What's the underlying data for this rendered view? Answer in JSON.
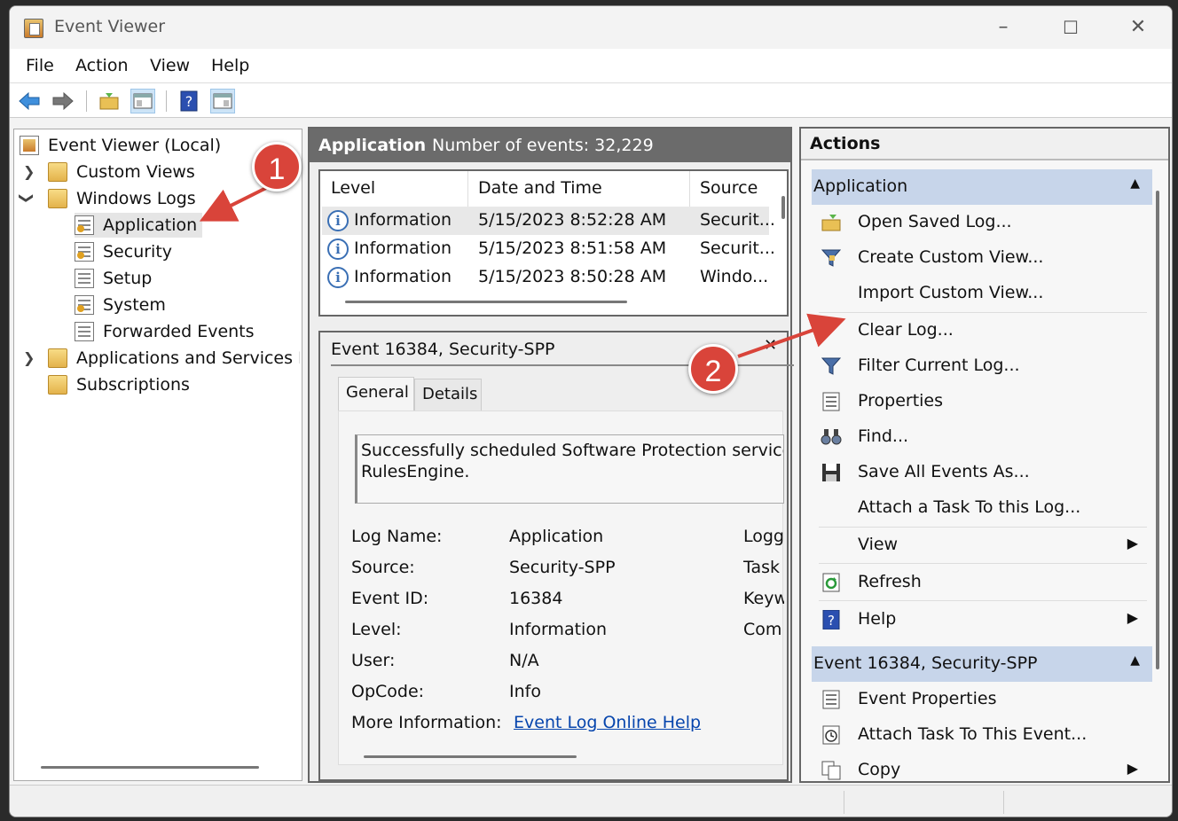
{
  "window": {
    "title": "Event Viewer",
    "controls": {
      "minimize": "–",
      "maximize": "☐",
      "close": "✕"
    }
  },
  "menu": [
    "File",
    "Action",
    "View",
    "Help"
  ],
  "toolbar": [
    "back-icon",
    "forward-icon",
    "open-folder-icon",
    "show-hide-tree-icon",
    "help-icon",
    "show-hide-action-pane-icon"
  ],
  "tree": {
    "root": "Event Viewer (Local)",
    "custom_views": "Custom Views",
    "windows_logs": "Windows Logs",
    "application": "Application",
    "security": "Security",
    "setup": "Setup",
    "system": "System",
    "forwarded": "Forwarded Events",
    "apps_services": "Applications and Services Lo",
    "subscriptions": "Subscriptions"
  },
  "middle": {
    "log_name": "Application",
    "event_count": "Number of events: 32,229",
    "columns": [
      "Level",
      "Date and Time",
      "Source"
    ],
    "rows": [
      {
        "level": "Information",
        "datetime": "5/15/2023 8:52:28 AM",
        "source": "Securit..."
      },
      {
        "level": "Information",
        "datetime": "5/15/2023 8:51:58 AM",
        "source": "Securit..."
      },
      {
        "level": "Information",
        "datetime": "5/15/2023 8:50:28 AM",
        "source": "Windo..."
      }
    ],
    "detail_title": "Event 16384, Security-SPP",
    "tabs": [
      "General",
      "Details"
    ],
    "message_line1": "Successfully scheduled Software Protection service for",
    "message_line2": "RulesEngine.",
    "fields": {
      "log_name_label": "Log Name:",
      "log_name_value": "Application",
      "source_label": "Source:",
      "source_value": "Security-SPP",
      "event_id_label": "Event ID:",
      "event_id_value": "16384",
      "level_label": "Level:",
      "level_value": "Information",
      "user_label": "User:",
      "user_value": "N/A",
      "opcode_label": "OpCode:",
      "opcode_value": "Info",
      "more_info_label": "More Information:",
      "more_info_link": "Event Log Online Help",
      "right_col": [
        "Logg",
        "Task",
        "Keyw",
        "Com"
      ]
    }
  },
  "actions": {
    "title": "Actions",
    "group1": "Application",
    "items1": [
      {
        "label": "Open Saved Log...",
        "icon": "open-folder-icon"
      },
      {
        "label": "Create Custom View...",
        "icon": "filter-icon"
      },
      {
        "label": "Import Custom View...",
        "icon": ""
      },
      {
        "label": "Clear Log...",
        "icon": ""
      },
      {
        "label": "Filter Current Log...",
        "icon": "filter-icon"
      },
      {
        "label": "Properties",
        "icon": "properties-icon"
      },
      {
        "label": "Find...",
        "icon": "binoculars-icon"
      },
      {
        "label": "Save All Events As...",
        "icon": "save-icon"
      },
      {
        "label": "Attach a Task To this Log...",
        "icon": ""
      },
      {
        "label": "View",
        "icon": ""
      },
      {
        "label": "Refresh",
        "icon": "refresh-icon"
      },
      {
        "label": "Help",
        "icon": "help-icon"
      }
    ],
    "group2": "Event 16384, Security-SPP",
    "items2": [
      {
        "label": "Event Properties",
        "icon": "properties-icon"
      },
      {
        "label": "Attach Task To This Event...",
        "icon": "clock-icon"
      },
      {
        "label": "Copy",
        "icon": "copy-icon"
      }
    ]
  },
  "annotations": [
    "1",
    "2"
  ],
  "colors": {
    "annotation": "#d9443a",
    "group_header": "#c7d5ea",
    "pane_header": "#6b6b6b"
  }
}
